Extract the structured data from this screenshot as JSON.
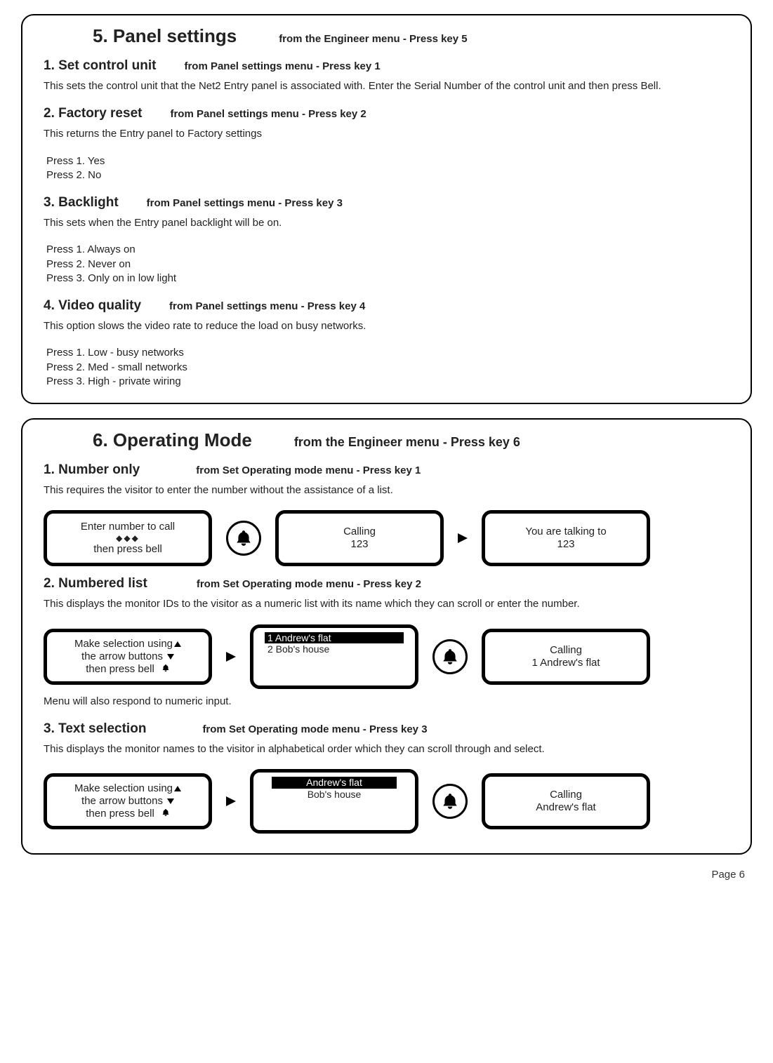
{
  "panel5": {
    "title": "5. Panel settings",
    "sub": "from the Engineer menu - Press key 5",
    "s1": {
      "title": "1. Set control unit",
      "sub": "from Panel settings menu - Press key 1",
      "body": "This sets the control unit that the Net2 Entry panel is associated with. Enter the Serial Number of the control unit and then press Bell."
    },
    "s2": {
      "title": "2. Factory reset",
      "sub": "from Panel settings menu - Press key 2",
      "body": "This returns the Entry panel to Factory settings",
      "opt1": "Press 1. Yes",
      "opt2": "Press 2. No"
    },
    "s3": {
      "title": "3. Backlight",
      "sub": "from Panel settings menu - Press key 3",
      "body": "This sets when the Entry panel backlight will be on.",
      "opt1": "Press 1. Always on",
      "opt2": "Press 2. Never on",
      "opt3": "Press 3. Only on in low light"
    },
    "s4": {
      "title": "4. Video quality",
      "sub": "from Panel settings menu - Press key 4",
      "body": "This option slows the video rate to reduce the load on busy networks.",
      "opt1": "Press 1. Low -  busy networks",
      "opt2": "Press 2. Med -  small networks",
      "opt3": "Press 3. High - private wiring"
    }
  },
  "panel6": {
    "title": "6. Operating Mode",
    "sub": "from the Engineer menu - Press key 6",
    "s1": {
      "title": "1. Number only",
      "sub": "from Set Operating mode menu - Press key 1",
      "body": "This requires the visitor to enter the number without the assistance of a list.",
      "screen1_l1": "Enter number to call",
      "screen1_l2": "◆◆◆",
      "screen1_l3": "then press bell",
      "screen2_l1": "Calling",
      "screen2_l2": "123",
      "screen3_l1": "You are talking to",
      "screen3_l2": "123"
    },
    "s2": {
      "title": "2. Numbered list",
      "sub": "from Set Operating mode menu - Press key 2",
      "body": "This displays the monitor IDs to the visitor as a numeric list with its name which they can scroll or enter the number.",
      "screen1_l1": "Make selection using",
      "screen1_l2": "the arrow buttons",
      "screen1_l3": "then press bell",
      "screen2_r1": "1   Andrew's flat",
      "screen2_r2": "2   Bob's house",
      "screen3_l1": "Calling",
      "screen3_l2": "1   Andrew's flat",
      "note": "Menu will also respond to numeric input."
    },
    "s3": {
      "title": "3. Text selection",
      "sub": "from Set Operating mode menu - Press key 3",
      "body": "This displays the monitor names to the visitor in alphabetical order which they can scroll through and select.",
      "screen1_l1": "Make selection using",
      "screen1_l2": "the arrow buttons",
      "screen1_l3": "then press bell",
      "screen2_r1": "Andrew's flat",
      "screen2_r2": "Bob's house",
      "screen3_l1": "Calling",
      "screen3_l2": "Andrew's flat"
    }
  },
  "footer": "Page  6"
}
